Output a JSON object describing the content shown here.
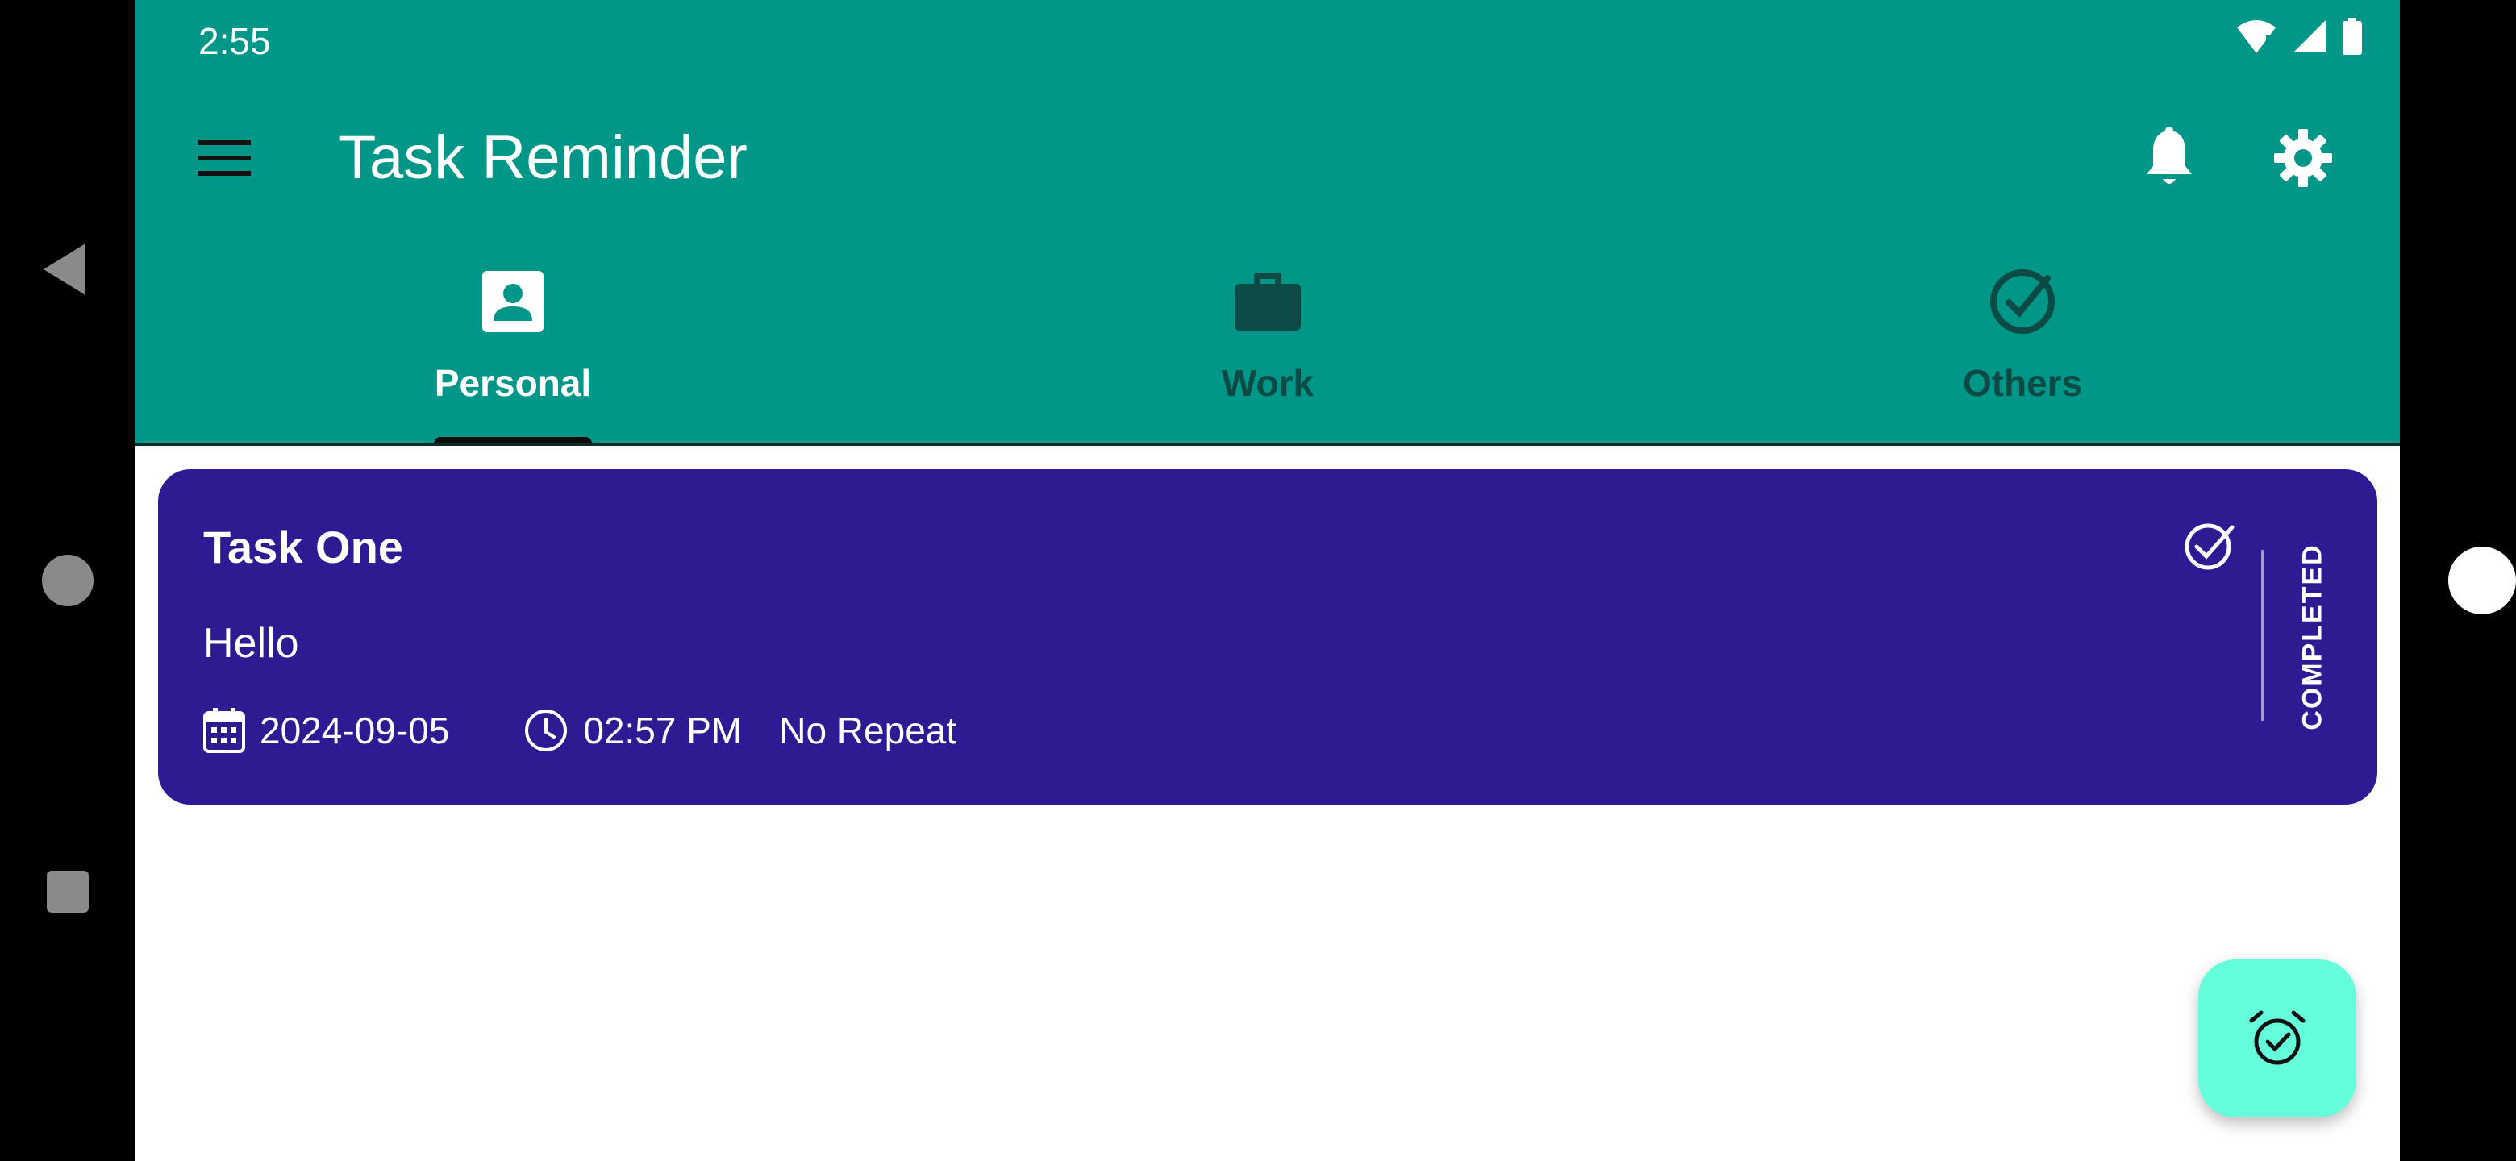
{
  "status_bar": {
    "time": "2:55",
    "icons": [
      "wifi-alert-icon",
      "cell-signal-icon",
      "battery-icon"
    ]
  },
  "app_bar": {
    "title": "Task Reminder",
    "menu_icon": "menu-icon",
    "actions": [
      "bell-icon",
      "gear-icon"
    ],
    "background_color": "#009688"
  },
  "tabs": [
    {
      "label": "Personal",
      "icon": "contact-card-icon",
      "active": true
    },
    {
      "label": "Work",
      "icon": "briefcase-icon",
      "active": false
    },
    {
      "label": "Others",
      "icon": "check-circle-icon",
      "active": false
    }
  ],
  "tasks": [
    {
      "title": "Task One",
      "note": "Hello",
      "date": "2024-09-05",
      "time": "02:57 PM",
      "repeat": "No Repeat",
      "status": "COMPLETED",
      "card_color": "#2e1a93"
    }
  ],
  "fab": {
    "icon": "alarm-check-icon",
    "color": "#64ffda"
  },
  "system_nav": [
    "back-icon",
    "home-icon",
    "recents-icon"
  ]
}
